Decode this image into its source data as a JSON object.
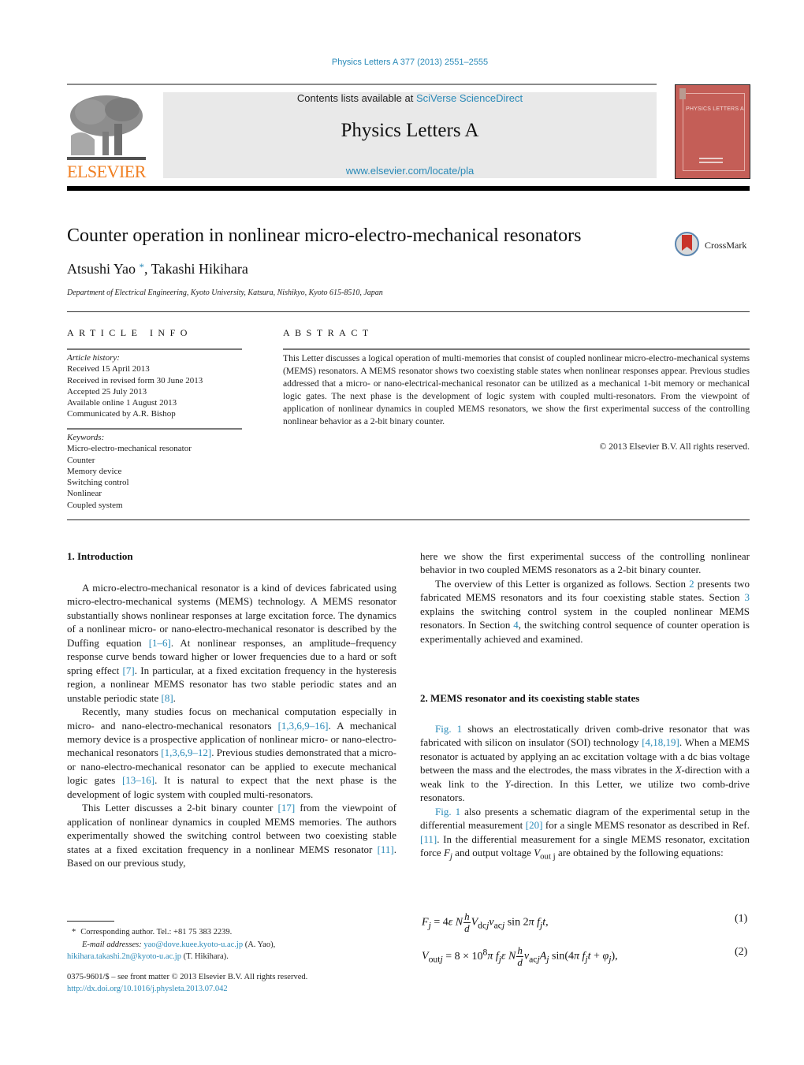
{
  "journal_ref": "Physics Letters A 377 (2013) 2551–2555",
  "header": {
    "contents_prefix": "Contents lists available at ",
    "contents_link": "SciVerse ScienceDirect",
    "journal_title": "Physics Letters A",
    "journal_url": "www.elsevier.com/locate/pla",
    "publisher_logo_text": "ELSEVIER",
    "cover_title": "PHYSICS LETTERS A"
  },
  "colors": {
    "link": "#2a8ab8",
    "elsevier_orange": "#f07f22",
    "cover_red": "#c45e57",
    "header_box": "#e9e9e9"
  },
  "article": {
    "title": "Counter operation in nonlinear micro-electro-mechanical resonators",
    "crossmark_label": "CrossMark",
    "authors": [
      {
        "name": "Atsushi Yao",
        "mark": "*"
      },
      {
        "name": "Takashi Hikihara",
        "mark": ""
      }
    ],
    "author_separator": ", ",
    "affiliation": "Department of Electrical Engineering, Kyoto University, Katsura, Nishikyo, Kyoto 615-8510, Japan"
  },
  "article_info": {
    "heading": "ARTICLE INFO",
    "history_label": "Article history:",
    "history": [
      "Received 15 April 2013",
      "Received in revised form 30 June 2013",
      "Accepted 25 July 2013",
      "Available online 1 August 2013",
      "Communicated by A.R. Bishop"
    ],
    "keywords_label": "Keywords:",
    "keywords": [
      "Micro-electro-mechanical resonator",
      "Counter",
      "Memory device",
      "Switching control",
      "Nonlinear",
      "Coupled system"
    ]
  },
  "abstract": {
    "heading": "ABSTRACT",
    "text": "This Letter discusses a logical operation of multi-memories that consist of coupled nonlinear micro-electro-mechanical systems (MEMS) resonators. A MEMS resonator shows two coexisting stable states when nonlinear responses appear. Previous studies addressed that a micro- or nano-electrical-mechanical resonator can be utilized as a mechanical 1-bit memory or mechanical logic gates. The next phase is the development of logic system with coupled multi-resonators. From the viewpoint of application of nonlinear dynamics in coupled MEMS resonators, we show the first experimental success of the controlling nonlinear behavior as a 2-bit binary counter.",
    "copyright": "© 2013 Elsevier B.V. All rights reserved."
  },
  "section1": {
    "heading": "1.  Introduction",
    "p1": {
      "a": "A micro-electro-mechanical resonator is a kind of devices fabricated using micro-electro-mechanical systems (MEMS) technology. A MEMS resonator substantially shows nonlinear responses at large excitation force. The dynamics of a nonlinear micro- or nano-electro-mechanical resonator is described by the Duffing equation ",
      "ref1": "[1–6]",
      "b": ". At nonlinear responses, an amplitude–frequency response curve bends toward higher or lower frequencies due to a hard or soft spring effect ",
      "ref2": "[7]",
      "c": ". In particular, at a fixed excitation frequency in the hysteresis region, a nonlinear MEMS resonator has two stable periodic states and an unstable periodic state ",
      "ref3": "[8]",
      "d": "."
    },
    "p2": {
      "a": "Recently, many studies focus on mechanical computation especially in micro- and nano-electro-mechanical resonators ",
      "ref1": "[1,3,6,9–16]",
      "b": ". A mechanical memory device is a prospective application of nonlinear micro- or nano-electro-mechanical resonators ",
      "ref2": "[1,3,6,9–12]",
      "c": ". Previous studies demonstrated that a micro- or nano-electro-mechanical resonator can be applied to execute mechanical logic gates ",
      "ref3": "[13–16]",
      "d": ". It is natural to expect that the next phase is the development of logic system with coupled multi-resonators."
    },
    "p3": {
      "a": "This Letter discusses a 2-bit binary counter ",
      "ref1": "[17]",
      "b": " from the viewpoint of application of nonlinear dynamics in coupled MEMS memories. The authors experimentally showed the switching control between two coexisting stable states at a fixed excitation frequency in a nonlinear MEMS resonator ",
      "ref2": "[11]",
      "c": ". Based on our previous study,"
    },
    "p4": "here we show the first experimental success of the controlling nonlinear behavior in two coupled MEMS resonators as a 2-bit binary counter.",
    "p5": {
      "a": "The overview of this Letter is organized as follows. Section ",
      "ref1": "2",
      "b": " presents two fabricated MEMS resonators and its four coexisting stable states. Section ",
      "ref2": "3",
      "c": " explains the switching control system in the coupled nonlinear MEMS resonators. In Section ",
      "ref3": "4",
      "d": ", the switching control sequence of counter operation is experimentally achieved and examined."
    }
  },
  "section2": {
    "heading": "2.  MEMS resonator and its coexisting stable states",
    "p1": {
      "ref1": "Fig. 1",
      "a": " shows an electrostatically driven comb-drive resonator that was fabricated with silicon on insulator (SOI) technology ",
      "ref2": "[4,18,19]",
      "b": ". When a MEMS resonator is actuated by applying an ac excitation voltage with a dc bias voltage between the mass and the electrodes, the mass vibrates in the ",
      "x": "X",
      "c": "-direction with a weak link to the ",
      "y": "Y",
      "d": "-direction. In this Letter, we utilize two comb-drive resonators."
    },
    "p2": {
      "ref1": "Fig. 1",
      "a": " also presents a schematic diagram of the experimental setup in the differential measurement ",
      "ref2": "[20]",
      "b": " for a single MEMS resonator as described in Ref. ",
      "ref3": "[11]",
      "c": ". In the differential measurement for a single MEMS resonator, excitation force ",
      "f": "F",
      "fsub": "j",
      "d": " and output voltage ",
      "v": "V",
      "vsub": "out j",
      "e": " are obtained by the following equations:"
    },
    "equations": [
      {
        "number": "(1)"
      },
      {
        "number": "(2)"
      }
    ]
  },
  "footnote": {
    "mark": "*",
    "corresponding": "Corresponding author. Tel.: +81 75 383 2239.",
    "email_label": "E-mail addresses:",
    "email1": "yao@dove.kuee.kyoto-u.ac.jp",
    "email1_owner": " (A. Yao),",
    "email2": "hikihara.takashi.2n@kyoto-u.ac.jp",
    "email2_owner": " (T. Hikihara)."
  },
  "front_matter": {
    "issn_line": "0375-9601/$ – see front matter  © 2013 Elsevier B.V. All rights reserved.",
    "doi": "http://dx.doi.org/10.1016/j.physleta.2013.07.042"
  }
}
